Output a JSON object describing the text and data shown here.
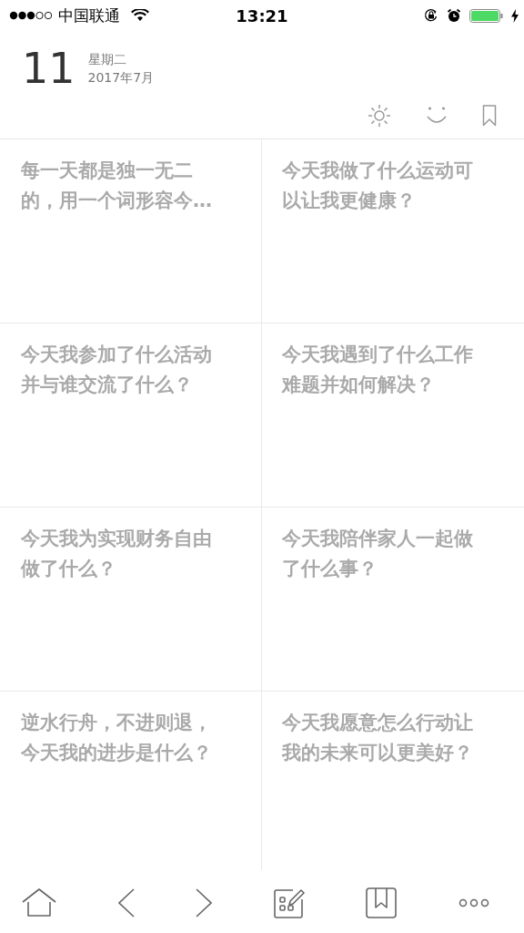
{
  "status_bar": {
    "carrier": "中国联通",
    "time": "13:21"
  },
  "header": {
    "day": "11",
    "weekday": "星期二",
    "month": "2017年7月"
  },
  "cards": [
    {
      "text": "每一天都是独一无二的，用一个词形容今…"
    },
    {
      "text": "今天我做了什么运动可以让我更健康？"
    },
    {
      "text": "今天我参加了什么活动并与谁交流了什么？"
    },
    {
      "text": "今天我遇到了什么工作难题并如何解决？"
    },
    {
      "text": "今天我为实现财务自由做了什么？"
    },
    {
      "text": "今天我陪伴家人一起做了什么事？"
    },
    {
      "text": "逆水行舟，不进则退，今天我的进步是什么？"
    },
    {
      "text": "今天我愿意怎么行动让我的未来可以更美好？"
    }
  ]
}
